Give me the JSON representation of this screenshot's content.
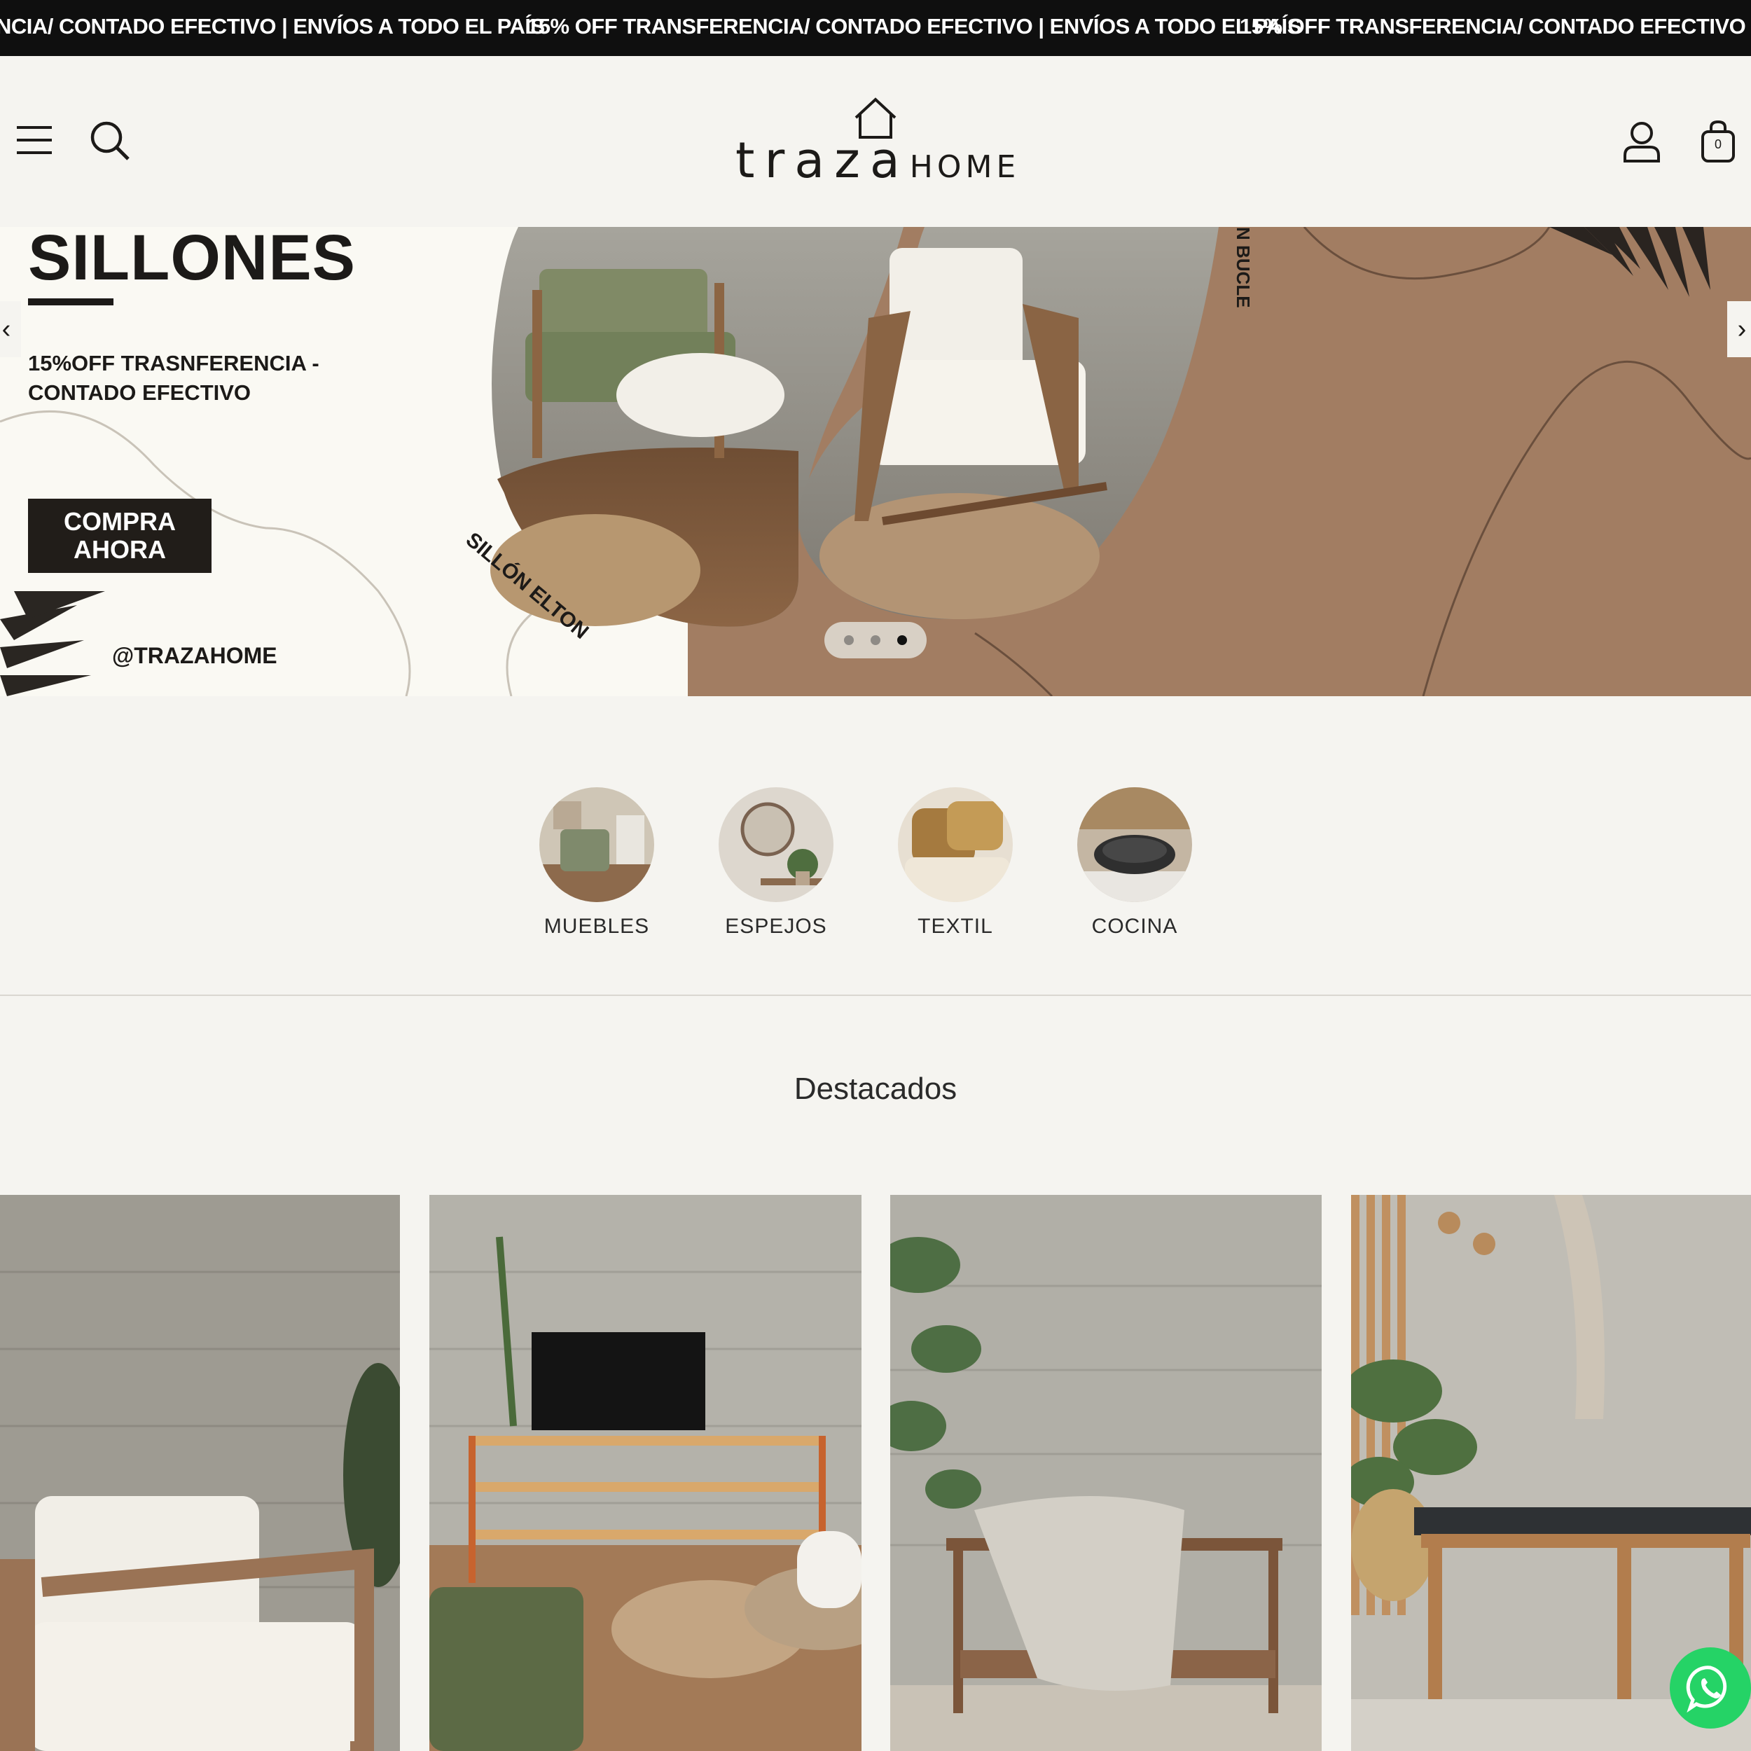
{
  "announcement": {
    "text": "15% OFF TRANSFERENCIA/ CONTADO EFECTIVO | ENVÍOS A TODO EL PAÍS",
    "lead_fragment": "NCIA/ CONTADO EFECTIVO | ENVÍOS A TODO EL PAÍS",
    "tail_fragment": "15% OFF TRANSFERENCIA/ CONTADO EFECTIVO | ENVÍO"
  },
  "header": {
    "logo_word": "traza",
    "logo_suffix": "HOME",
    "cart_count": "0"
  },
  "hero": {
    "title": "SILLONES",
    "promo": "15%OFF TRASNFERENCIA - CONTADO EFECTIVO",
    "cta_line1": "COMPRA",
    "cta_line2": "AHORA",
    "handle": "@TRAZAHOME",
    "product_label_left": "SILLÓN ELTON",
    "product_label_right": "N BUCLE",
    "slide_count": 3,
    "active_slide": 3
  },
  "categories": [
    {
      "label": "MUEBLES"
    },
    {
      "label": "ESPEJOS"
    },
    {
      "label": "TEXTIL"
    },
    {
      "label": "COCINA"
    }
  ],
  "featured": {
    "title": "Destacados"
  },
  "colors": {
    "announcement_bg": "#0f0f0f",
    "page_bg": "#f5f4f0",
    "hero_brown": "#a27d62",
    "cta_bg": "#211d19",
    "whatsapp": "#25d366"
  },
  "icons": [
    "menu-icon",
    "search-icon",
    "house-logo-icon",
    "user-icon",
    "bag-icon",
    "chevron-left-icon",
    "chevron-right-icon",
    "whatsapp-icon"
  ]
}
